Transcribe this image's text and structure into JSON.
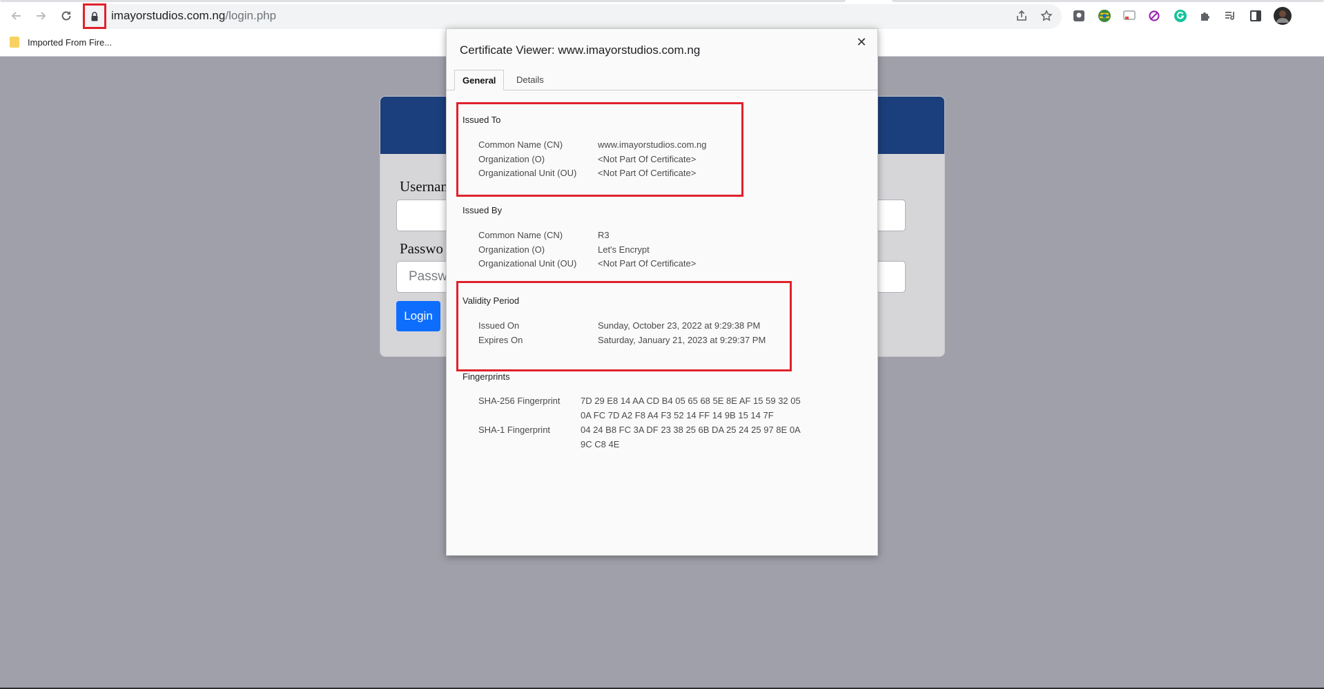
{
  "browser": {
    "url_domain": "imayorstudios.com.ng",
    "url_path": "/login.php",
    "bookmark_label": "Imported From Fire..."
  },
  "page": {
    "username_label": "Usernam",
    "password_label": "Passwo",
    "password_placeholder": "Passw",
    "login_button": "Login",
    "colors": {
      "header": "#1b3f7c",
      "button": "#0d6efd"
    }
  },
  "dialog": {
    "title": "Certificate Viewer: www.imayorstudios.com.ng",
    "close": "✕",
    "tabs": [
      "General",
      "Details"
    ],
    "issued_to": {
      "title": "Issued To",
      "rows": [
        {
          "label": "Common Name (CN)",
          "value": "www.imayorstudios.com.ng"
        },
        {
          "label": "Organization (O)",
          "value": "<Not Part Of Certificate>"
        },
        {
          "label": "Organizational Unit (OU)",
          "value": "<Not Part Of Certificate>"
        }
      ]
    },
    "issued_by": {
      "title": "Issued By",
      "rows": [
        {
          "label": "Common Name (CN)",
          "value": "R3"
        },
        {
          "label": "Organization (O)",
          "value": "Let's Encrypt"
        },
        {
          "label": "Organizational Unit (OU)",
          "value": "<Not Part Of Certificate>"
        }
      ]
    },
    "validity": {
      "title": "Validity Period",
      "rows": [
        {
          "label": "Issued On",
          "value": "Sunday, October 23, 2022 at 9:29:38 PM"
        },
        {
          "label": "Expires On",
          "value": "Saturday, January 21, 2023 at 9:29:37 PM"
        }
      ]
    },
    "fingerprints": {
      "title": "Fingerprints",
      "rows": [
        {
          "label": "SHA-256 Fingerprint",
          "value": "7D 29 E8 14 AA CD B4 05 65 68 5E 8E AF 15 59 32 05 0A FC 7D A2 F8 A4 F3 52 14 FF 14 9B 15 14 7F"
        },
        {
          "label": "SHA-1 Fingerprint",
          "value": "04 24 B8 FC 3A DF 23 38 25 6B DA 25 24 25 97 8E 0A 9C C8 4E"
        }
      ]
    }
  },
  "annotations": {
    "highlight_color": "#e0212a"
  }
}
